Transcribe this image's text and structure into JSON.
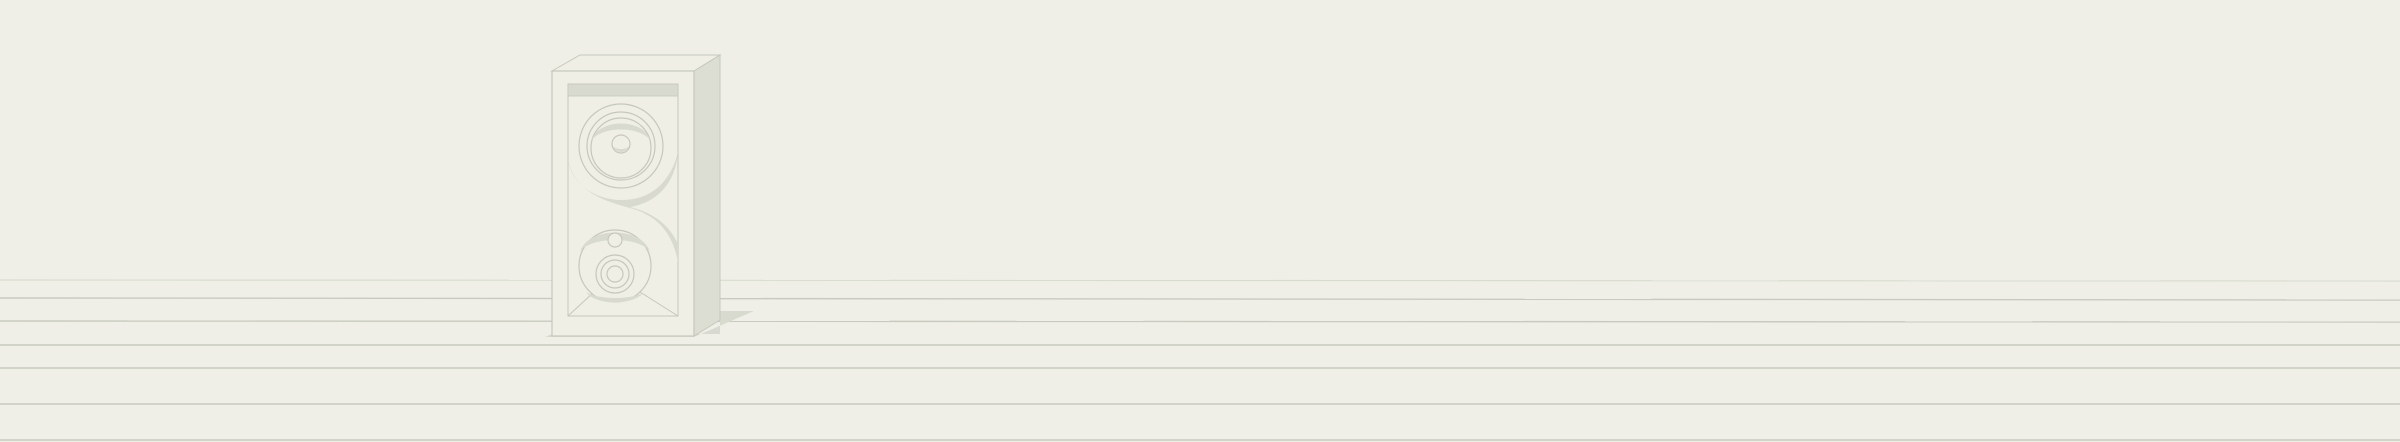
{
  "scene": {
    "subject": "speaker-illustration",
    "colors": {
      "background": "#efefe7",
      "cabinet_face": "#efefe6",
      "cabinet_side": "#dcddd3",
      "cabinet_top": "#efefe6",
      "outline": "#c6c7bc",
      "shadow_fill": "#d9dacf",
      "floor_line": "#c9cabe",
      "floor_line_faint": "#dadbd0"
    },
    "components": [
      "cabinet",
      "woofer",
      "tweeter",
      "floor-lines"
    ]
  }
}
